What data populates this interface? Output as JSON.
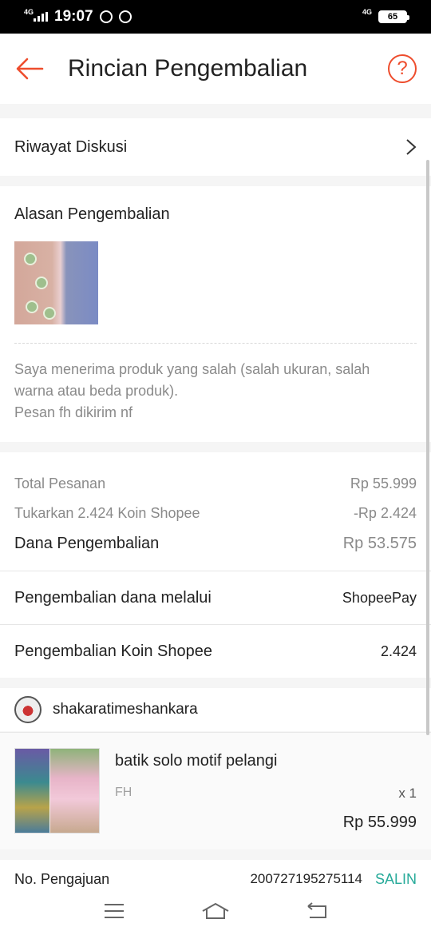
{
  "status_bar": {
    "network_left": "4G",
    "time": "19:07",
    "network_right": "4G",
    "battery": "65"
  },
  "header": {
    "title": "Rincian Pengembalian",
    "help_glyph": "?"
  },
  "discussion": {
    "label": "Riwayat Diskusi"
  },
  "reason": {
    "title": "Alasan Pengembalian",
    "text_line1": "Saya menerima produk yang salah (salah ukuran, salah",
    "text_line2": "warna atau beda produk).",
    "text_line3": "Pesan fh dikirim nf"
  },
  "amounts": {
    "total_label": "Total Pesanan",
    "total_value": "Rp 55.999",
    "coin_label": "Tukarkan 2.424 Koin Shopee",
    "coin_value": "-Rp 2.424",
    "refund_label": "Dana Pengembalian",
    "refund_value": "Rp 53.575"
  },
  "refund_method": {
    "label": "Pengembalian dana melalui",
    "value": "ShopeePay"
  },
  "coin_refund": {
    "label": "Pengembalian Koin Shopee",
    "value": "2.424"
  },
  "shop": {
    "name": "shakaratimeshankara"
  },
  "product": {
    "name": "batik solo motif pelangi",
    "variation": "FH",
    "quantity": "x 1",
    "price": "Rp 55.999"
  },
  "request": {
    "label": "No. Pengajuan",
    "number": "200727195275114",
    "copy_label": "SALIN"
  },
  "colors": {
    "accent": "#ee4d2d",
    "copy": "#26aa99"
  }
}
